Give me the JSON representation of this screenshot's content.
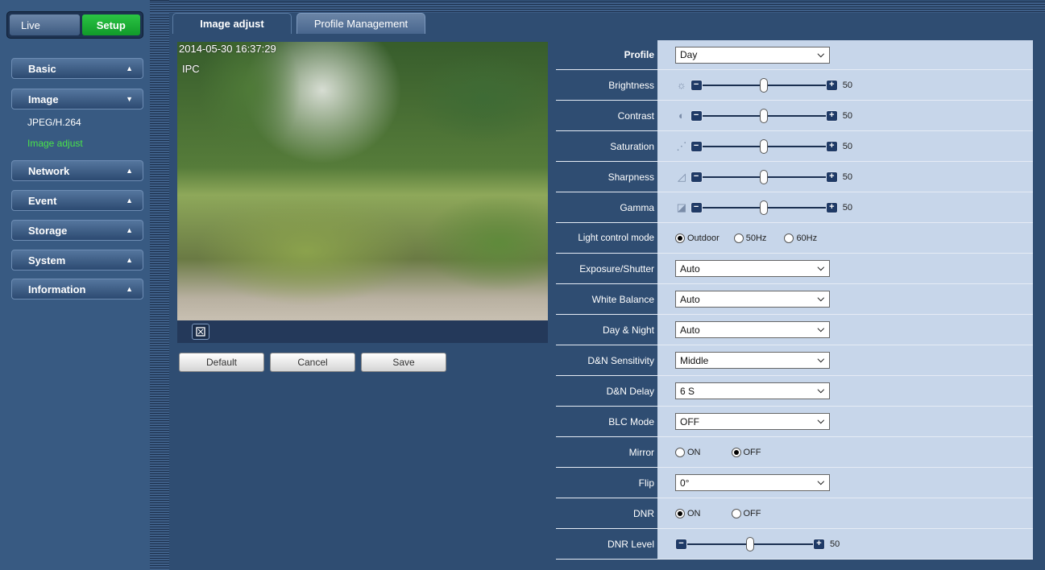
{
  "mode": {
    "live": "Live",
    "setup": "Setup"
  },
  "sidebar": {
    "items": [
      {
        "label": "Basic",
        "arrow": "▲"
      },
      {
        "label": "Image",
        "arrow": "▼"
      },
      {
        "label": "Network",
        "arrow": "▲"
      },
      {
        "label": "Event",
        "arrow": "▲"
      },
      {
        "label": "Storage",
        "arrow": "▲"
      },
      {
        "label": "System",
        "arrow": "▲"
      },
      {
        "label": "Information",
        "arrow": "▲"
      }
    ],
    "image_sub": [
      "JPEG/H.264",
      "Image adjust"
    ]
  },
  "tabs": [
    "Image adjust",
    "Profile Management"
  ],
  "video": {
    "timestamp": "2014-05-30 16:37:29",
    "channel": "IPC"
  },
  "buttons": {
    "default": "Default",
    "cancel": "Cancel",
    "save": "Save"
  },
  "settings": {
    "profile": {
      "label": "Profile",
      "value": "Day"
    },
    "brightness": {
      "label": "Brightness",
      "value": "50",
      "level": 0.5
    },
    "contrast": {
      "label": "Contrast",
      "value": "50",
      "level": 0.5
    },
    "saturation": {
      "label": "Saturation",
      "value": "50",
      "level": 0.5
    },
    "sharpness": {
      "label": "Sharpness",
      "value": "50",
      "level": 0.5
    },
    "gamma": {
      "label": "Gamma",
      "value": "50",
      "level": 0.5
    },
    "light_control": {
      "label": "Light control mode",
      "options": [
        "Outdoor",
        "50Hz",
        "60Hz"
      ],
      "selected": "Outdoor"
    },
    "exposure": {
      "label": "Exposure/Shutter",
      "value": "Auto"
    },
    "white_balance": {
      "label": "White Balance",
      "value": "Auto"
    },
    "day_night": {
      "label": "Day & Night",
      "value": "Auto"
    },
    "dn_sensitivity": {
      "label": "D&N Sensitivity",
      "value": "Middle"
    },
    "dn_delay": {
      "label": "D&N Delay",
      "value": "6 S"
    },
    "blc": {
      "label": "BLC Mode",
      "value": "OFF"
    },
    "mirror": {
      "label": "Mirror",
      "options": [
        "ON",
        "OFF"
      ],
      "selected": "OFF"
    },
    "flip": {
      "label": "Flip",
      "value": "0°"
    },
    "dnr": {
      "label": "DNR",
      "options": [
        "ON",
        "OFF"
      ],
      "selected": "ON"
    },
    "dnr_level": {
      "label": "DNR Level",
      "value": "50",
      "level": 0.5
    }
  },
  "icons": {
    "brightness": "sun-icon",
    "contrast": "contrast-icon",
    "saturation": "saturation-icon",
    "sharpness": "sharpness-icon",
    "gamma": "gamma-icon",
    "fullscreen": "fullscreen-icon"
  }
}
